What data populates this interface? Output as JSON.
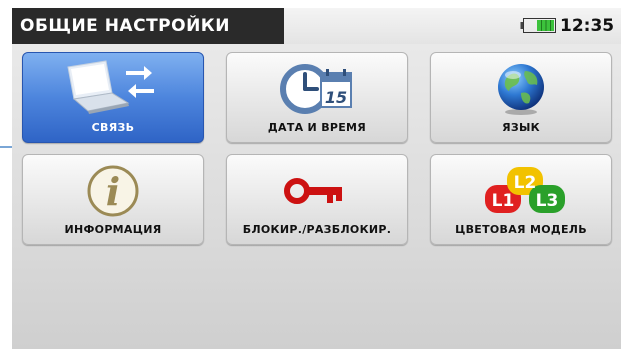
{
  "header": {
    "title": "ОБЩИЕ НАСТРОЙКИ",
    "time": "12:35",
    "battery_icon": "battery-icon"
  },
  "tiles": [
    {
      "label": "СВЯЗЬ",
      "icon": "laptop-exchange-icon",
      "selected": true
    },
    {
      "label": "ДАТА И ВРЕМЯ",
      "icon": "clock-calendar-icon",
      "calendar_day": "15",
      "selected": false
    },
    {
      "label": "ЯЗЫК",
      "icon": "globe-icon",
      "selected": false
    },
    {
      "label": "ИНФОРМАЦИЯ",
      "icon": "info-icon",
      "icon_letter": "i",
      "selected": false
    },
    {
      "label": "БЛОКИР./РАЗБЛОКИР.",
      "icon": "key-icon",
      "selected": false
    },
    {
      "label": "ЦВЕТОВАЯ МОДЕЛЬ",
      "icon": "color-model-icon",
      "badges": [
        "L1",
        "L2",
        "L3"
      ],
      "selected": false
    }
  ],
  "colors": {
    "selected_tile": "#4d85dd",
    "title_bg": "#2a2a2a",
    "battery": "#3cc23c",
    "key": "#cc1111",
    "l1": "#e02020",
    "l2": "#f2c200",
    "l3": "#2aa02a"
  }
}
